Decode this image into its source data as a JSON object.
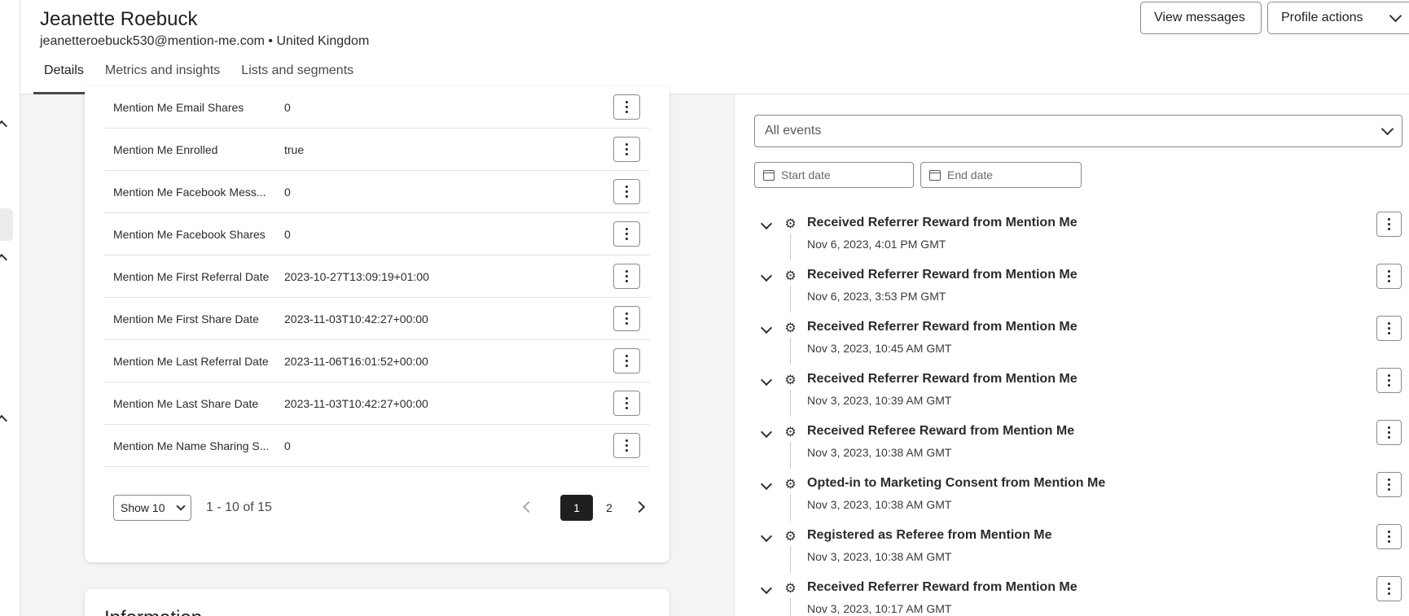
{
  "profile": {
    "name": "Jeanette Roebuck",
    "subtitle": "jeanetteroebuck530@mention-me.com • United Kingdom"
  },
  "header_actions": {
    "view_messages": "View messages",
    "profile_actions": "Profile actions"
  },
  "tabs": [
    {
      "label": "Details",
      "active": true
    },
    {
      "label": "Metrics and insights",
      "active": false
    },
    {
      "label": "Lists and segments",
      "active": false
    }
  ],
  "properties": [
    {
      "key": "Mention Me Email Shares",
      "value": "0"
    },
    {
      "key": "Mention Me Enrolled",
      "value": "true"
    },
    {
      "key": "Mention Me Facebook Mess...",
      "value": "0"
    },
    {
      "key": "Mention Me Facebook Shares",
      "value": "0"
    },
    {
      "key": "Mention Me First Referral Date",
      "value": "2023-10-27T13:09:19+01:00"
    },
    {
      "key": "Mention Me First Share Date",
      "value": "2023-11-03T10:42:27+00:00"
    },
    {
      "key": "Mention Me Last Referral Date",
      "value": "2023-11-06T16:01:52+00:00"
    },
    {
      "key": "Mention Me Last Share Date",
      "value": "2023-11-03T10:42:27+00:00"
    },
    {
      "key": "Mention Me Name Sharing S...",
      "value": "0"
    }
  ],
  "pagination": {
    "show_label": "Show 10",
    "range": "1 - 10 of 15",
    "pages": [
      "1",
      "2"
    ],
    "current_page": "1"
  },
  "info_card": {
    "title": "Information"
  },
  "events_filter": {
    "selected": "All events",
    "start_placeholder": "Start date",
    "end_placeholder": "End date"
  },
  "events": [
    {
      "title": "Received Referrer Reward from Mention Me",
      "time": "Nov 6, 2023, 4:01 PM GMT"
    },
    {
      "title": "Received Referrer Reward from Mention Me",
      "time": "Nov 6, 2023, 3:53 PM GMT"
    },
    {
      "title": "Received Referrer Reward from Mention Me",
      "time": "Nov 3, 2023, 10:45 AM GMT"
    },
    {
      "title": "Received Referrer Reward from Mention Me",
      "time": "Nov 3, 2023, 10:39 AM GMT"
    },
    {
      "title": "Received Referee Reward from Mention Me",
      "time": "Nov 3, 2023, 10:38 AM GMT"
    },
    {
      "title": "Opted-in to Marketing Consent from Mention Me",
      "time": "Nov 3, 2023, 10:38 AM GMT"
    },
    {
      "title": "Registered as Referee from Mention Me",
      "time": "Nov 3, 2023, 10:38 AM GMT"
    },
    {
      "title": "Received Referrer Reward from Mention Me",
      "time": "Nov 3, 2023, 10:17 AM GMT"
    }
  ]
}
